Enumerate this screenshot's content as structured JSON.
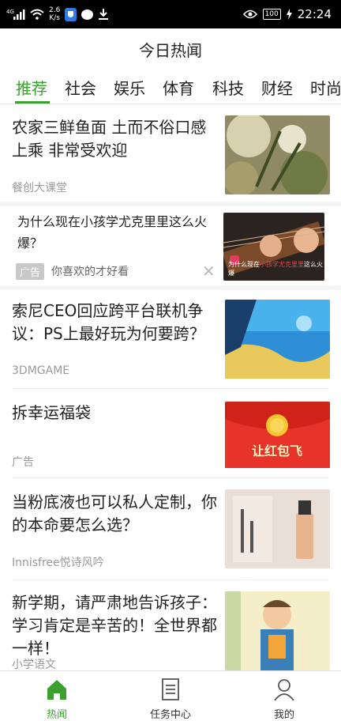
{
  "status_bar": {
    "signal": "4G",
    "net_speed": "2.6",
    "net_unit": "K/s",
    "battery": "100",
    "time": "22:24"
  },
  "app": {
    "title": "今日热闻"
  },
  "tabs": [
    {
      "label": "推荐",
      "active": true
    },
    {
      "label": "社会"
    },
    {
      "label": "娱乐"
    },
    {
      "label": "体育"
    },
    {
      "label": "科技"
    },
    {
      "label": "财经"
    },
    {
      "label": "时尚"
    }
  ],
  "feed": [
    {
      "title": "农家三鲜鱼面 土而不俗口感上乘 非常受欢迎",
      "source": "餐创大课堂"
    },
    {
      "title": "为什么现在小孩学尤克里里这么火爆？",
      "ad_label": "广告",
      "ad_text": "你喜欢的才好看",
      "close": "✕",
      "caption_prefix": "为什么现在",
      "caption_highlight": "小孩学尤克里里",
      "caption_suffix": "这么火爆"
    },
    {
      "title": "索尼CEO回应跨平台联机争议：PS上最好玩为何要跨？",
      "source": "3DMGAME"
    },
    {
      "title": "拆幸运福袋",
      "source": "广告",
      "thumb_text": "让红包飞"
    },
    {
      "title": "当粉底液也可以私人定制，你的本命要怎么选？",
      "source": "Innisfree悦诗风吟"
    },
    {
      "title": "新学期，请严肃地告诉孩子：学习肯定是辛苦的！全世界都一样！",
      "source": "小学语文"
    }
  ],
  "bottom_nav": [
    {
      "label": "热闻",
      "icon": "home-icon",
      "active": true
    },
    {
      "label": "任务中心",
      "icon": "task-list-icon"
    },
    {
      "label": "我的",
      "icon": "user-icon"
    }
  ],
  "colors": {
    "accent": "#3aa12e",
    "status_bar_bg": "#000000",
    "divider": "#f4f4f4"
  }
}
